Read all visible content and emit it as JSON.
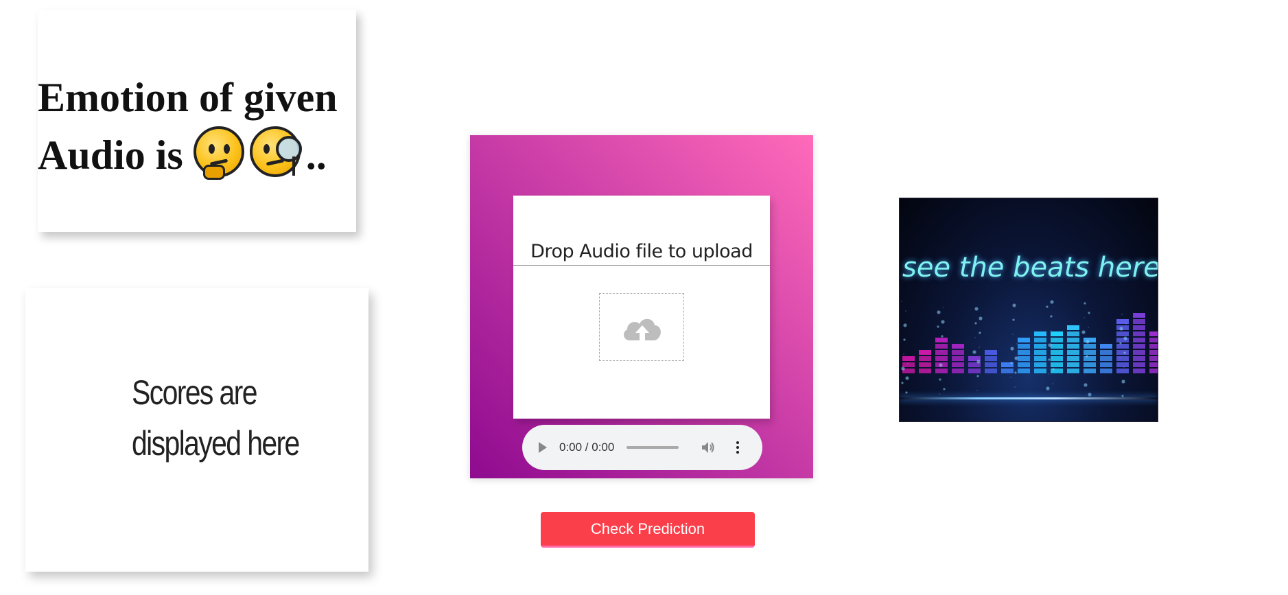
{
  "emotion_card": {
    "line1": "Emotion of given",
    "line2": "Audio is",
    "trailing": "..",
    "emojis": [
      "thinking-face",
      "face-with-monocle"
    ]
  },
  "scores_card": {
    "line1": "Scores are",
    "line2": "displayed here"
  },
  "upload": {
    "title": "Drop Audio file to upload",
    "icon": "cloud-upload-icon"
  },
  "audio_player": {
    "time": "0:00 / 0:00"
  },
  "actions": {
    "check_label": "Check Prediction"
  },
  "beats_image": {
    "caption": "see the beats here"
  },
  "colors": {
    "panel_gradient_start": "#8e0a8f",
    "panel_gradient_end": "#ff6ab9",
    "button_bg": "#fb3f4a",
    "beats_text": "#7ff2f0"
  }
}
